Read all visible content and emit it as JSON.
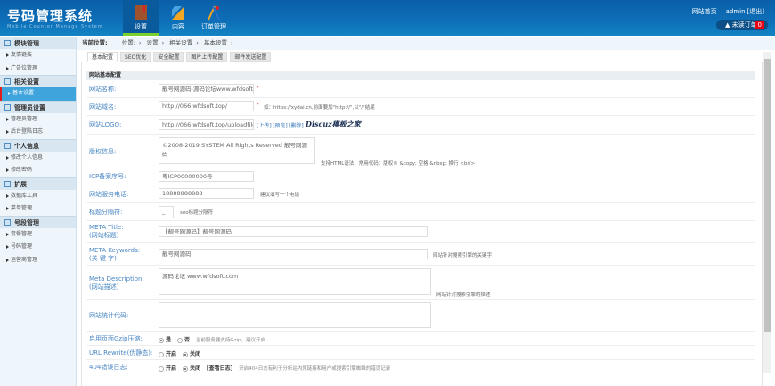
{
  "header": {
    "title": "号码管理系统",
    "subtitle": "Mobile Counter Manage System",
    "nav": [
      {
        "label": "设置",
        "icon": "book-icon"
      },
      {
        "label": "内容",
        "icon": "ruler-icon"
      },
      {
        "label": "订单管理",
        "icon": "tools-icon"
      }
    ],
    "links": {
      "home": "网站首页",
      "user": "admin",
      "logout": "[退出]"
    },
    "unread": {
      "label": "未读订单",
      "count": "0"
    }
  },
  "sidebar": [
    {
      "title": "模块管理",
      "items": [
        "友情链接",
        "广告位管理"
      ]
    },
    {
      "title": "相关设置",
      "items": [
        "基本设置"
      ]
    },
    {
      "title": "管理员设置",
      "items": [
        "管理员管理",
        "后台登陆日志"
      ]
    },
    {
      "title": "个人信息",
      "items": [
        "修改个人信息",
        "修改密码"
      ]
    },
    {
      "title": "扩展",
      "items": [
        "数据库工具",
        "菜单管理"
      ]
    },
    {
      "title": "号段管理",
      "items": [
        "套餐管理",
        "号码管理",
        "运营商管理"
      ]
    }
  ],
  "breadcrumb": {
    "label": "当前位置:",
    "items": [
      "位置:",
      "设置",
      "相关设置",
      "基本设置"
    ]
  },
  "tabs": [
    "基本配置",
    "SEO优化",
    "安全配置",
    "图片上传配置",
    "邮件发送配置"
  ],
  "section_title": "网站基本配置",
  "form": {
    "site_name": {
      "label": "网站名称:",
      "value": "靓号网源码-源码论坛www.wfdsoft.",
      "req": "*"
    },
    "domain": {
      "label": "网站域名:",
      "value": "http://066.wfdsoft.top/",
      "req": "*",
      "hint": "如：https://xydai.cn,前面要加\"http://\",以\"/\"结尾"
    },
    "logo": {
      "label": "网站LOGO:",
      "value": "http://066.wfdsoft.top/uploadfile,",
      "upload": "[上传]",
      "preview": "[预览]",
      "delete": "[删除]",
      "logo_text": "Discuz模板之家"
    },
    "copyright": {
      "label": "版权信息:",
      "value": "©2008-2019 SYSTEM All Rights Reserved  靓号网源码",
      "hint": "支持HTML语法，常用代码：版权© &copy; 空格 &nbsp; 换行 <br/>"
    },
    "icp": {
      "label": "ICP备案序号:",
      "value": "粤ICP00000000号"
    },
    "phone": {
      "label": "网站服务电话:",
      "value": "18888888888",
      "hint": "建议填写一个电话"
    },
    "separator": {
      "label": "标题分隔符:",
      "value": "_",
      "hint": "seo标题分隔符"
    },
    "meta_title": {
      "label": "META Title:",
      "label2": "(网站标题)",
      "value": "【靓号网源码】靓号网源码"
    },
    "meta_keywords": {
      "label": "META Keywords:",
      "label2": "(关 键 字)",
      "value": "靓号网源码",
      "hint": "网站针对搜索引擎的关键字"
    },
    "meta_desc": {
      "label": "Meta Description:",
      "label2": "(网站描述)",
      "value": "源码论坛 www.wfdsoft.com",
      "hint": "网站针对搜索引擎的描述"
    },
    "stats": {
      "label": "网站统计代码:",
      "value": ""
    },
    "gzip": {
      "label": "启用页面Gzip压缩:",
      "yes": "是",
      "no": "否",
      "selected": "是",
      "hint": "当前服务器支持Gzip，建议开启"
    },
    "rewrite": {
      "label": "URL Rewrite(伪静态):",
      "on": "开启",
      "off": "关闭",
      "selected": "关闭"
    },
    "log404": {
      "label": "404错误日志:",
      "on": "开启",
      "off": "关闭",
      "selected": "关闭",
      "view": "[查看日志]",
      "hint": "开启404日志有利于分析站内死链接和用户或搜索引擎蜘蛛的错误记录"
    }
  }
}
